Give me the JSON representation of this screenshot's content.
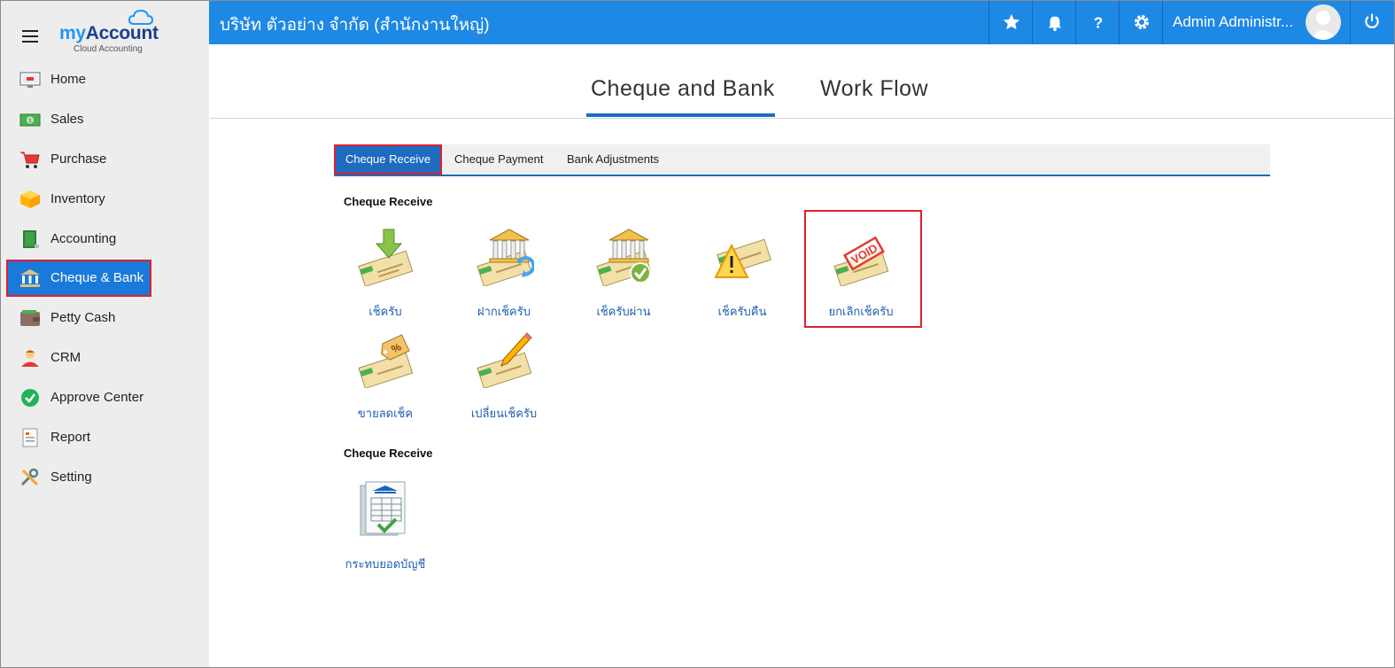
{
  "app": {
    "brand_my": "my",
    "brand_account": "Account",
    "tagline": "Cloud Accounting"
  },
  "topbar": {
    "company": "บริษัท ตัวอย่าง จำกัด (สำนักงานใหญ่)",
    "user_name": "Admin Administr..."
  },
  "sidebar": {
    "items": [
      {
        "label": "Home"
      },
      {
        "label": "Sales"
      },
      {
        "label": "Purchase"
      },
      {
        "label": "Inventory"
      },
      {
        "label": "Accounting"
      },
      {
        "label": "Cheque & Bank"
      },
      {
        "label": "Petty Cash"
      },
      {
        "label": "CRM"
      },
      {
        "label": "Approve Center"
      },
      {
        "label": "Report"
      },
      {
        "label": "Setting"
      }
    ],
    "active": "Cheque & Bank"
  },
  "main_tabs": [
    {
      "label": "Cheque and Bank"
    },
    {
      "label": "Work Flow"
    }
  ],
  "sub_tabs": [
    {
      "label": "Cheque Receive"
    },
    {
      "label": "Cheque Payment"
    },
    {
      "label": "Bank Adjustments"
    }
  ],
  "sections": [
    {
      "title": "Cheque Receive",
      "tiles": [
        {
          "label": "เช็ครับ"
        },
        {
          "label": "ฝากเช็ครับ"
        },
        {
          "label": "เช็ครับผ่าน"
        },
        {
          "label": "เช็ครับคืน"
        },
        {
          "label": "ยกเลิกเช็ครับ"
        },
        {
          "label": "ขายลดเช็ค"
        },
        {
          "label": "เปลี่ยนเช็ครับ"
        }
      ]
    },
    {
      "title": "Cheque Receive",
      "tiles": [
        {
          "label": "กระทบยอดบัญชี"
        }
      ]
    }
  ],
  "void_stamp": "VOID",
  "colors": {
    "topbar": "#1e88e5",
    "accent": "#1e6bbf",
    "highlight": "#e21f2c",
    "sidebar": "#ededed"
  }
}
